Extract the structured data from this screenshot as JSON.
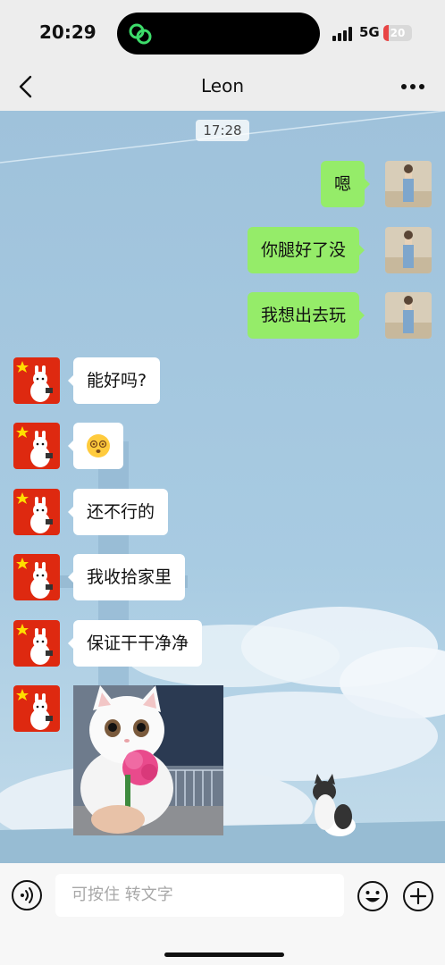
{
  "status_bar": {
    "time": "20:29",
    "network": "5G",
    "battery_level": "20",
    "battery_fraction": 0.2
  },
  "header": {
    "title": "Leon",
    "back_icon": "chevron-left-icon",
    "more_icon": "more-dots-icon"
  },
  "conversation": {
    "timestamp": "17:28",
    "messages": [
      {
        "from": "me",
        "type": "text",
        "text": "嗯"
      },
      {
        "from": "me",
        "type": "text",
        "text": "你腿好了没"
      },
      {
        "from": "me",
        "type": "text",
        "text": "我想出去玩"
      },
      {
        "from": "other",
        "type": "text",
        "text": "能好吗?"
      },
      {
        "from": "other",
        "type": "emoji",
        "text": "😵‍💫"
      },
      {
        "from": "other",
        "type": "text",
        "text": "还不行的"
      },
      {
        "from": "other",
        "type": "text",
        "text": "我收拾家里"
      },
      {
        "from": "other",
        "type": "text",
        "text": "保证干干净净"
      },
      {
        "from": "other",
        "type": "image",
        "text": ""
      }
    ]
  },
  "input_bar": {
    "placeholder": "可按住 转文字",
    "voice_icon": "voice-icon",
    "emoji_icon": "emoji-icon",
    "plus_icon": "plus-icon"
  },
  "colors": {
    "outgoing_bubble": "#95ec69",
    "incoming_bubble": "#ffffff",
    "chat_background": "#a9c8dd",
    "battery_low": "#e84545"
  }
}
